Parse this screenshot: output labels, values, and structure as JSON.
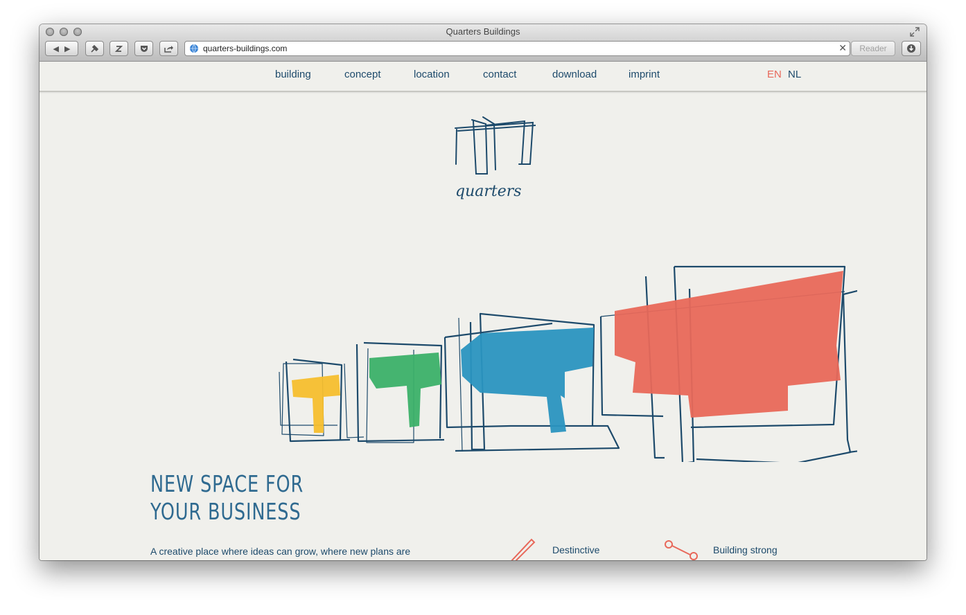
{
  "window": {
    "title": "Quarters Buildings",
    "url": "quarters-buildings.com",
    "reader_label": "Reader",
    "clear_glyph": "✕"
  },
  "nav": {
    "items": [
      {
        "label": "building"
      },
      {
        "label": "concept"
      },
      {
        "label": "location"
      },
      {
        "label": "contact"
      },
      {
        "label": "download"
      },
      {
        "label": "imprint"
      }
    ],
    "languages": [
      {
        "label": "EN",
        "active": true
      },
      {
        "label": "NL",
        "active": false
      }
    ]
  },
  "brand": {
    "logo_text": "quarters"
  },
  "hero": {
    "headline_line1": "NEW SPACE FOR",
    "headline_line2": "YOUR BUSINESS",
    "intro": "A creative place where ideas can grow, where new plans are"
  },
  "features": [
    {
      "title": "Destinctive",
      "icon": "pencil-icon"
    },
    {
      "title": "Building strong",
      "icon": "connection-icon"
    }
  ],
  "colors": {
    "brand_navy": "#1d4a6b",
    "accent_red": "#e8685a",
    "yellow": "#f6be2e",
    "green": "#3bb069",
    "blue": "#2a93c0",
    "background": "#f0f0ec"
  }
}
